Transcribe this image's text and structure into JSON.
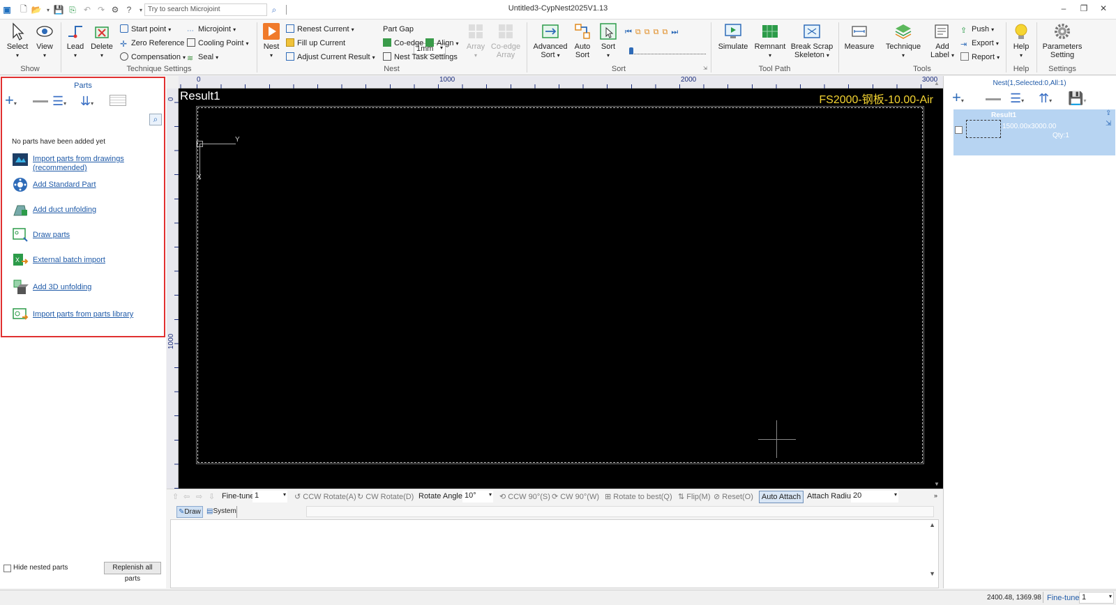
{
  "titlebar": {
    "title": "Untitled3-CypNest2025V1.13",
    "search_placeholder": "Try to search Microjoint"
  },
  "ribbon": {
    "show": {
      "group": "Show",
      "select": "Select",
      "view": "View"
    },
    "technique": {
      "group": "Technique Settings",
      "lead": "Lead",
      "delete": "Delete",
      "start_point": "Start point",
      "zero_reference": "Zero Reference",
      "compensation": "Compensation",
      "microjoint": "Microjoint",
      "cooling_point": "Cooling Point",
      "seal": "Seal"
    },
    "nest": {
      "group": "Nest",
      "nest": "Nest",
      "renest_current": "Renest Current",
      "fill_up_current": "Fill up Current",
      "adjust_current_result": "Adjust Current Result",
      "part_gap_label": "Part Gap",
      "part_gap_value": "1mm",
      "co_edge": "Co-edge",
      "align": "Align",
      "nest_task_settings": "Nest Task Settings",
      "array": "Array",
      "co_edge_array_1": "Co-edge",
      "co_edge_array_2": "Array"
    },
    "sort": {
      "group": "Sort",
      "advanced_sort_1": "Advanced",
      "advanced_sort_2": "Sort",
      "auto_sort_1": "Auto",
      "auto_sort_2": "Sort",
      "sort": "Sort"
    },
    "toolpath": {
      "group": "Tool Path",
      "simulate": "Simulate",
      "remnant": "Remnant",
      "break_scrap_1": "Break Scrap",
      "break_scrap_2": "Skeleton"
    },
    "tools": {
      "group": "Tools",
      "measure": "Measure",
      "technique": "Technique",
      "add_label_1": "Add",
      "add_label_2": "Label",
      "push": "Push",
      "export": "Export",
      "report": "Report"
    },
    "help": {
      "group": "Help",
      "help": "Help"
    },
    "settings": {
      "group": "Settings",
      "params_1": "Parameters",
      "params_2": "Setting"
    }
  },
  "parts_panel": {
    "title": "Parts",
    "empty_message": "No parts have been added yet",
    "links": {
      "import_drawings_1": "Import parts from drawings",
      "import_drawings_2": "(recommended)",
      "add_standard": "Add Standard Part",
      "add_duct": "Add duct unfolding",
      "draw_parts": "Draw parts",
      "external_batch": "External batch import",
      "add_3d": "Add 3D unfolding",
      "import_library": "Import parts from parts library"
    },
    "hide_nested": "Hide nested parts",
    "replenish": "Replenish all parts"
  },
  "canvas": {
    "result_label": "Result1",
    "material_label": "FS2000-钢板-10.00-Air",
    "ruler_top": [
      "0",
      "1000",
      "2000",
      "3000"
    ],
    "ruler_left": [
      "0",
      "1000"
    ],
    "axis_y": "Y",
    "axis_x": "X"
  },
  "nest_panel": {
    "header": "Nest(1,Selected:0,All:1)",
    "result_name": "Result1",
    "sheet_size": "1500.00x3000.00",
    "qty": "Qty:1"
  },
  "bottom_toolbar": {
    "fine_tune_label": "Fine-tune",
    "fine_tune_value": "1",
    "ccw_rotate": "CCW Rotate(A)",
    "cw_rotate": "CW Rotate(D)",
    "rotate_angle_label": "Rotate Angle",
    "rotate_angle_value": "10°",
    "ccw90": "CCW 90°(S)",
    "cw90": "CW 90°(W)",
    "rotate_best": "Rotate to best(Q)",
    "flip": "Flip(M)",
    "reset": "Reset(O)",
    "auto_attach": "Auto Attach",
    "attach_radius_label": "Attach Radius",
    "attach_radius_value": "20"
  },
  "console_tabs": {
    "draw": "Draw",
    "system": "System"
  },
  "statusbar": {
    "coords": "2400.48, 1369.98",
    "fine_tune_label": "Fine-tune",
    "fine_tune_value": "1"
  },
  "colors": {
    "accent": "#1f5aa8",
    "canvas_bg": "#000000",
    "material_text": "#f5d532",
    "selection_bg": "#b7d4f2",
    "highlight_border": "#e03030"
  }
}
